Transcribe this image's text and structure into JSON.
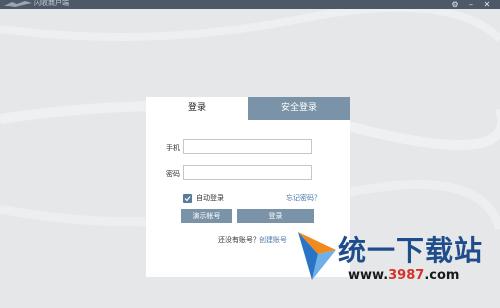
{
  "window": {
    "title": "闪收商户端",
    "settings_icon": "gear-icon",
    "minimize_icon": "minimize-icon",
    "close_icon": "close-icon"
  },
  "login_panel": {
    "tabs": [
      {
        "label": "登录",
        "active": true
      },
      {
        "label": "安全登录",
        "active": false
      }
    ],
    "phone_label": "手机",
    "phone_value": "",
    "password_label": "密码",
    "password_value": "",
    "auto_login_label": "自动登录",
    "auto_login_checked": true,
    "forgot_password": "忘记密码？",
    "demo_button": "演示帐号",
    "login_button": "登录",
    "no_account_text": "还没有账号？",
    "register_link": "创建账号"
  },
  "watermark": {
    "title": "统一下载站",
    "url_prefix": "www.",
    "url_domain": "3987",
    "url_suffix": ".com"
  },
  "colors": {
    "titlebar": "#4d5868",
    "background": "#e6e7e9",
    "tab_inactive": "#7b93a9",
    "button": "#7b93a9",
    "link": "#4a78a8"
  }
}
